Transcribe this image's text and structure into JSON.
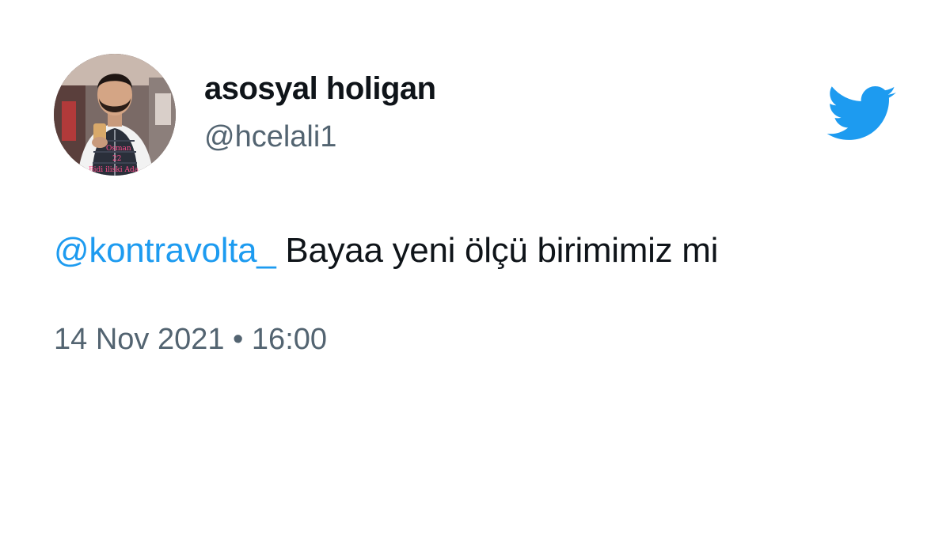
{
  "author": {
    "display_name": "asosyal holigan",
    "handle": "@hcelali1",
    "avatar_caption": [
      "Osman",
      "22",
      "Bidi iliski Ada"
    ]
  },
  "tweet": {
    "mention": "@kontravolta_",
    "text": " Bayaa yeni ölçü birimimiz mi"
  },
  "meta": {
    "date": "14 Nov 2021",
    "separator": " • ",
    "time": "16:00"
  },
  "icons": {
    "brand": "twitter-bird-icon"
  },
  "colors": {
    "brand": "#1d9bf0",
    "text": "#0f1419",
    "secondary": "#536471"
  }
}
